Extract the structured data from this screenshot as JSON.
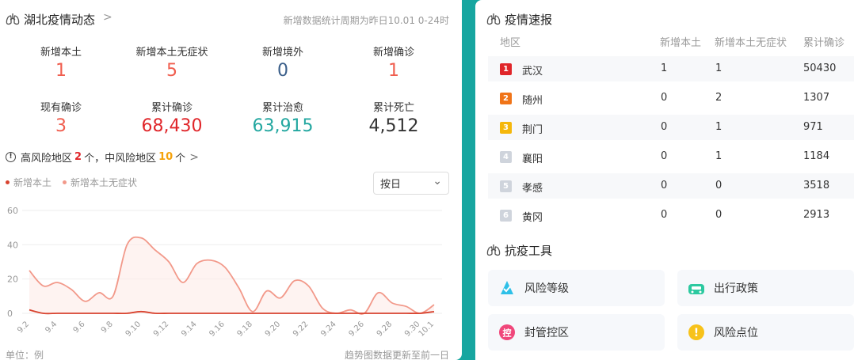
{
  "left_header": {
    "title": "湖北疫情动态",
    "chevron": ">",
    "note": "新增数据统计周期为昨日10.01 0-24时"
  },
  "stats": [
    {
      "label": "新增本土",
      "value": "1",
      "color": "#f05d4e"
    },
    {
      "label": "新增本土无症状",
      "value": "5",
      "color": "#f05d4e"
    },
    {
      "label": "新增境外",
      "value": "0",
      "color": "#3b5f8a"
    },
    {
      "label": "新增确诊",
      "value": "1",
      "color": "#f05d4e"
    },
    {
      "label": "现有确诊",
      "value": "3",
      "color": "#f05d4e"
    },
    {
      "label": "累计确诊",
      "value": "68,430",
      "color": "#e0262a"
    },
    {
      "label": "累计治愈",
      "value": "63,915",
      "color": "#23a7a0"
    },
    {
      "label": "累计死亡",
      "value": "4,512",
      "color": "#333333"
    }
  ],
  "risk": {
    "info_icon": "!",
    "prefix": "高风险地区",
    "high_count": "2",
    "mid_text": "个，中风险地区",
    "mid_count": "10",
    "suffix": "个",
    "chevron": ">"
  },
  "legend": {
    "s1": "新增本土",
    "s2": "新增本土无症状"
  },
  "mode_select": {
    "value": "按日",
    "arrow": "⌄"
  },
  "chart_data": {
    "type": "line",
    "x": [
      "9.2",
      "9.3",
      "9.4",
      "9.5",
      "9.6",
      "9.7",
      "9.8",
      "9.9",
      "9.10",
      "9.11",
      "9.12",
      "9.13",
      "9.14",
      "9.15",
      "9.16",
      "9.17",
      "9.18",
      "9.19",
      "9.20",
      "9.21",
      "9.22",
      "9.23",
      "9.24",
      "9.25",
      "9.26",
      "9.27",
      "9.28",
      "9.29",
      "9.30",
      "10.1"
    ],
    "x_tick_labels": [
      "9.2",
      "9.4",
      "9.6",
      "9.8",
      "9.10",
      "9.12",
      "9.14",
      "9.16",
      "9.18",
      "9.20",
      "9.22",
      "9.24",
      "9.26",
      "9.28",
      "9.30",
      "10.1"
    ],
    "y_ticks": [
      "0",
      "20",
      "40",
      "60"
    ],
    "ylim": [
      0,
      60
    ],
    "series": [
      {
        "name": "新增本土",
        "color": "#d8432f",
        "values": [
          2,
          0,
          0,
          0,
          0,
          0,
          0,
          0,
          1,
          0,
          0,
          0,
          0,
          0,
          0,
          0,
          0,
          0,
          0,
          0,
          0,
          0,
          0,
          0,
          0,
          0,
          0,
          0,
          0,
          1
        ]
      },
      {
        "name": "新增本土无症状",
        "color": "#f2998a",
        "values": [
          25,
          16,
          18,
          14,
          7,
          12,
          10,
          40,
          44,
          37,
          30,
          18,
          29,
          31,
          27,
          15,
          1,
          13,
          9,
          19,
          16,
          3,
          0,
          2,
          0,
          12,
          6,
          4,
          0,
          5
        ]
      }
    ],
    "unit_label": "单位：例",
    "footnote": "趋势图数据更新至前一日"
  },
  "right_header": {
    "title": "疫情速报"
  },
  "table": {
    "headers": [
      "地区",
      "新增本土",
      "新增本土无症状",
      "累计确诊"
    ],
    "rows": [
      {
        "rank": "1",
        "rank_color": "#e0262a",
        "region": "武汉",
        "local": "1",
        "asym": "1",
        "total": "50430"
      },
      {
        "rank": "2",
        "rank_color": "#f07418",
        "region": "随州",
        "local": "0",
        "asym": "2",
        "total": "1307"
      },
      {
        "rank": "3",
        "rank_color": "#f5b70b",
        "region": "荆门",
        "local": "0",
        "asym": "1",
        "total": "971"
      },
      {
        "rank": "4",
        "rank_color": "#cfd4dc",
        "region": "襄阳",
        "local": "0",
        "asym": "1",
        "total": "1184"
      },
      {
        "rank": "5",
        "rank_color": "#cfd4dc",
        "region": "孝感",
        "local": "0",
        "asym": "0",
        "total": "3518"
      },
      {
        "rank": "6",
        "rank_color": "#cfd4dc",
        "region": "黄冈",
        "local": "0",
        "asym": "0",
        "total": "2913"
      }
    ]
  },
  "tools": {
    "title": "抗疫工具",
    "items": [
      {
        "label": "风险等级",
        "icon": "risk-level-icon"
      },
      {
        "label": "出行政策",
        "icon": "car-icon"
      },
      {
        "label": "封管控区",
        "icon": "control-zone-icon",
        "glyph": "控"
      },
      {
        "label": "风险点位",
        "icon": "risk-point-icon",
        "glyph": "!"
      }
    ]
  }
}
